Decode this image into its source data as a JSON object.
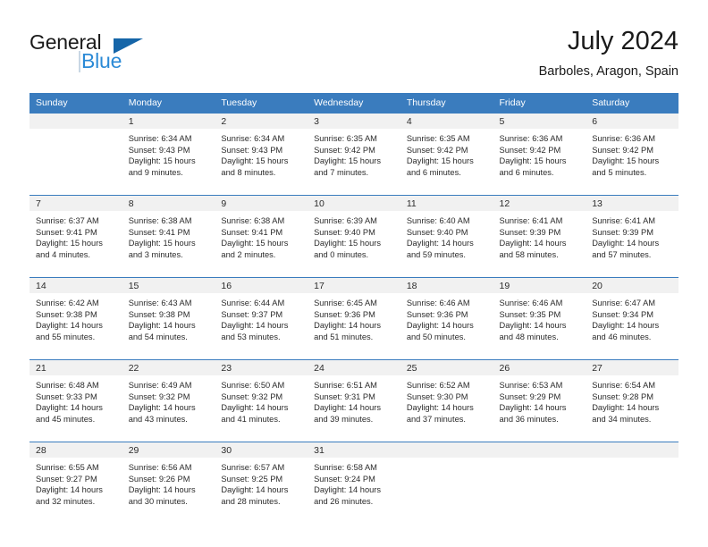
{
  "brand": {
    "word_one": "General",
    "word_two": "Blue",
    "accent_dark": "#1565a8",
    "accent_light": "#2b8ad6",
    "triangle_icon": "brand-triangle-icon"
  },
  "header": {
    "title": "July 2024",
    "subtitle": "Barboles, Aragon, Spain"
  },
  "calendar": {
    "header_bg": "#3a7cbe",
    "daynum_bg": "#f1f1f1",
    "weekday_headers": [
      "Sunday",
      "Monday",
      "Tuesday",
      "Wednesday",
      "Thursday",
      "Friday",
      "Saturday"
    ],
    "labels": {
      "sunrise": "Sunrise:",
      "sunset": "Sunset:",
      "daylight": "Daylight:"
    },
    "weeks": [
      [
        {
          "day": "",
          "sunrise": "",
          "sunset": "",
          "daylight_line1": "",
          "daylight_line2": ""
        },
        {
          "day": "1",
          "sunrise": "Sunrise: 6:34 AM",
          "sunset": "Sunset: 9:43 PM",
          "daylight_line1": "Daylight: 15 hours",
          "daylight_line2": "and 9 minutes."
        },
        {
          "day": "2",
          "sunrise": "Sunrise: 6:34 AM",
          "sunset": "Sunset: 9:43 PM",
          "daylight_line1": "Daylight: 15 hours",
          "daylight_line2": "and 8 minutes."
        },
        {
          "day": "3",
          "sunrise": "Sunrise: 6:35 AM",
          "sunset": "Sunset: 9:42 PM",
          "daylight_line1": "Daylight: 15 hours",
          "daylight_line2": "and 7 minutes."
        },
        {
          "day": "4",
          "sunrise": "Sunrise: 6:35 AM",
          "sunset": "Sunset: 9:42 PM",
          "daylight_line1": "Daylight: 15 hours",
          "daylight_line2": "and 6 minutes."
        },
        {
          "day": "5",
          "sunrise": "Sunrise: 6:36 AM",
          "sunset": "Sunset: 9:42 PM",
          "daylight_line1": "Daylight: 15 hours",
          "daylight_line2": "and 6 minutes."
        },
        {
          "day": "6",
          "sunrise": "Sunrise: 6:36 AM",
          "sunset": "Sunset: 9:42 PM",
          "daylight_line1": "Daylight: 15 hours",
          "daylight_line2": "and 5 minutes."
        }
      ],
      [
        {
          "day": "7",
          "sunrise": "Sunrise: 6:37 AM",
          "sunset": "Sunset: 9:41 PM",
          "daylight_line1": "Daylight: 15 hours",
          "daylight_line2": "and 4 minutes."
        },
        {
          "day": "8",
          "sunrise": "Sunrise: 6:38 AM",
          "sunset": "Sunset: 9:41 PM",
          "daylight_line1": "Daylight: 15 hours",
          "daylight_line2": "and 3 minutes."
        },
        {
          "day": "9",
          "sunrise": "Sunrise: 6:38 AM",
          "sunset": "Sunset: 9:41 PM",
          "daylight_line1": "Daylight: 15 hours",
          "daylight_line2": "and 2 minutes."
        },
        {
          "day": "10",
          "sunrise": "Sunrise: 6:39 AM",
          "sunset": "Sunset: 9:40 PM",
          "daylight_line1": "Daylight: 15 hours",
          "daylight_line2": "and 0 minutes."
        },
        {
          "day": "11",
          "sunrise": "Sunrise: 6:40 AM",
          "sunset": "Sunset: 9:40 PM",
          "daylight_line1": "Daylight: 14 hours",
          "daylight_line2": "and 59 minutes."
        },
        {
          "day": "12",
          "sunrise": "Sunrise: 6:41 AM",
          "sunset": "Sunset: 9:39 PM",
          "daylight_line1": "Daylight: 14 hours",
          "daylight_line2": "and 58 minutes."
        },
        {
          "day": "13",
          "sunrise": "Sunrise: 6:41 AM",
          "sunset": "Sunset: 9:39 PM",
          "daylight_line1": "Daylight: 14 hours",
          "daylight_line2": "and 57 minutes."
        }
      ],
      [
        {
          "day": "14",
          "sunrise": "Sunrise: 6:42 AM",
          "sunset": "Sunset: 9:38 PM",
          "daylight_line1": "Daylight: 14 hours",
          "daylight_line2": "and 55 minutes."
        },
        {
          "day": "15",
          "sunrise": "Sunrise: 6:43 AM",
          "sunset": "Sunset: 9:38 PM",
          "daylight_line1": "Daylight: 14 hours",
          "daylight_line2": "and 54 minutes."
        },
        {
          "day": "16",
          "sunrise": "Sunrise: 6:44 AM",
          "sunset": "Sunset: 9:37 PM",
          "daylight_line1": "Daylight: 14 hours",
          "daylight_line2": "and 53 minutes."
        },
        {
          "day": "17",
          "sunrise": "Sunrise: 6:45 AM",
          "sunset": "Sunset: 9:36 PM",
          "daylight_line1": "Daylight: 14 hours",
          "daylight_line2": "and 51 minutes."
        },
        {
          "day": "18",
          "sunrise": "Sunrise: 6:46 AM",
          "sunset": "Sunset: 9:36 PM",
          "daylight_line1": "Daylight: 14 hours",
          "daylight_line2": "and 50 minutes."
        },
        {
          "day": "19",
          "sunrise": "Sunrise: 6:46 AM",
          "sunset": "Sunset: 9:35 PM",
          "daylight_line1": "Daylight: 14 hours",
          "daylight_line2": "and 48 minutes."
        },
        {
          "day": "20",
          "sunrise": "Sunrise: 6:47 AM",
          "sunset": "Sunset: 9:34 PM",
          "daylight_line1": "Daylight: 14 hours",
          "daylight_line2": "and 46 minutes."
        }
      ],
      [
        {
          "day": "21",
          "sunrise": "Sunrise: 6:48 AM",
          "sunset": "Sunset: 9:33 PM",
          "daylight_line1": "Daylight: 14 hours",
          "daylight_line2": "and 45 minutes."
        },
        {
          "day": "22",
          "sunrise": "Sunrise: 6:49 AM",
          "sunset": "Sunset: 9:32 PM",
          "daylight_line1": "Daylight: 14 hours",
          "daylight_line2": "and 43 minutes."
        },
        {
          "day": "23",
          "sunrise": "Sunrise: 6:50 AM",
          "sunset": "Sunset: 9:32 PM",
          "daylight_line1": "Daylight: 14 hours",
          "daylight_line2": "and 41 minutes."
        },
        {
          "day": "24",
          "sunrise": "Sunrise: 6:51 AM",
          "sunset": "Sunset: 9:31 PM",
          "daylight_line1": "Daylight: 14 hours",
          "daylight_line2": "and 39 minutes."
        },
        {
          "day": "25",
          "sunrise": "Sunrise: 6:52 AM",
          "sunset": "Sunset: 9:30 PM",
          "daylight_line1": "Daylight: 14 hours",
          "daylight_line2": "and 37 minutes."
        },
        {
          "day": "26",
          "sunrise": "Sunrise: 6:53 AM",
          "sunset": "Sunset: 9:29 PM",
          "daylight_line1": "Daylight: 14 hours",
          "daylight_line2": "and 36 minutes."
        },
        {
          "day": "27",
          "sunrise": "Sunrise: 6:54 AM",
          "sunset": "Sunset: 9:28 PM",
          "daylight_line1": "Daylight: 14 hours",
          "daylight_line2": "and 34 minutes."
        }
      ],
      [
        {
          "day": "28",
          "sunrise": "Sunrise: 6:55 AM",
          "sunset": "Sunset: 9:27 PM",
          "daylight_line1": "Daylight: 14 hours",
          "daylight_line2": "and 32 minutes."
        },
        {
          "day": "29",
          "sunrise": "Sunrise: 6:56 AM",
          "sunset": "Sunset: 9:26 PM",
          "daylight_line1": "Daylight: 14 hours",
          "daylight_line2": "and 30 minutes."
        },
        {
          "day": "30",
          "sunrise": "Sunrise: 6:57 AM",
          "sunset": "Sunset: 9:25 PM",
          "daylight_line1": "Daylight: 14 hours",
          "daylight_line2": "and 28 minutes."
        },
        {
          "day": "31",
          "sunrise": "Sunrise: 6:58 AM",
          "sunset": "Sunset: 9:24 PM",
          "daylight_line1": "Daylight: 14 hours",
          "daylight_line2": "and 26 minutes."
        },
        {
          "day": "",
          "sunrise": "",
          "sunset": "",
          "daylight_line1": "",
          "daylight_line2": ""
        },
        {
          "day": "",
          "sunrise": "",
          "sunset": "",
          "daylight_line1": "",
          "daylight_line2": ""
        },
        {
          "day": "",
          "sunrise": "",
          "sunset": "",
          "daylight_line1": "",
          "daylight_line2": ""
        }
      ]
    ]
  }
}
